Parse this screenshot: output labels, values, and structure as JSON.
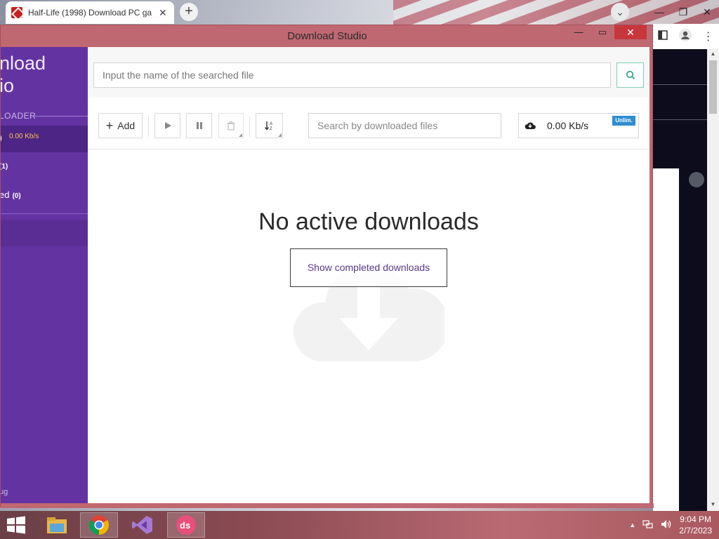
{
  "browser": {
    "tab_title": "Half-Life (1998) Download PC ga",
    "tab_close": "✕",
    "new_tab": "+",
    "dropdown": "⌄",
    "min": "—",
    "max": "❐",
    "close": "✕"
  },
  "app": {
    "window_title": "Download Studio",
    "win_min": "—",
    "win_max": "▭",
    "win_close": "✕",
    "sidebar": {
      "logo_line1": "nload",
      "logo_line2": "io",
      "section_label": "LOADER",
      "active_item_count": ")",
      "active_item_speed": "0.00 Kb/s",
      "item2_count": "(1)",
      "item3_label": "ed",
      "item3_count": "(0)",
      "footer": "ug"
    },
    "search": {
      "placeholder": "Input the name of the searched file"
    },
    "toolbar": {
      "add_label": "Add",
      "downloaded_search_placeholder": "Search by downloaded files",
      "speed": "0.00 Kb/s",
      "speed_badge": "Unlim."
    },
    "empty_state": {
      "title": "No active downloads",
      "button": "Show completed downloads"
    },
    "accent_color": "#6433a2",
    "brand_red": "#c06872"
  },
  "taskbar": {
    "time": "9:04 PM",
    "date": "2/7/2023",
    "apps": [
      "start-icon",
      "file-explorer-icon",
      "chrome-icon",
      "visual-studio-icon",
      "download-studio-icon"
    ]
  }
}
